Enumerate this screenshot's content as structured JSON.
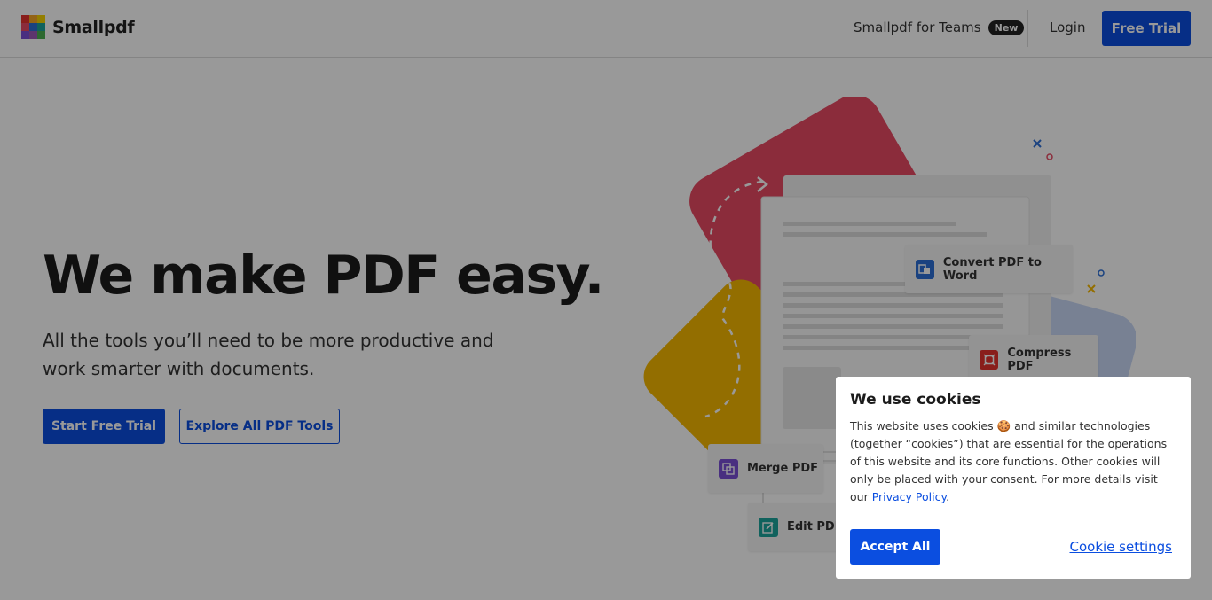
{
  "header": {
    "logo_text": "Smallpdf",
    "teams_label": "Smallpdf for Teams",
    "teams_badge": "New",
    "login_label": "Login",
    "free_trial_label": "Free Trial"
  },
  "hero": {
    "title": "We make PDF easy.",
    "subtitle": "All the tools you’ll need to be more productive and work smarter with documents.",
    "start_button": "Start Free Trial",
    "explore_button": "Explore All PDF Tools"
  },
  "illustration": {
    "tools": [
      {
        "label": "Convert PDF to Word",
        "icon": "convert-icon",
        "color": "#2c6fd6"
      },
      {
        "label": "Compress PDF",
        "icon": "compress-icon",
        "color": "#e5322d"
      },
      {
        "label": "Merge PDF",
        "icon": "merge-icon",
        "color": "#7b4fd6"
      },
      {
        "label": "Edit PDF",
        "icon": "edit-icon",
        "color": "#1ba39c"
      }
    ]
  },
  "cookie_dialog": {
    "title": "We use cookies",
    "text_before": "This website uses cookies",
    "emoji": "🍪",
    "text_after": " and similar technologies (together “cookies”) that are essential for the operations of this website and its core functions. Other cookies will only be placed with your consent. For more details visit our ",
    "privacy_link": "Privacy Policy",
    "text_end": ".",
    "accept_label": "Accept All",
    "settings_label": "Cookie settings"
  },
  "colors": {
    "brand_blue": "#0b4ee0",
    "red_shape": "#e84a63",
    "yellow_shape": "#f5b800"
  }
}
